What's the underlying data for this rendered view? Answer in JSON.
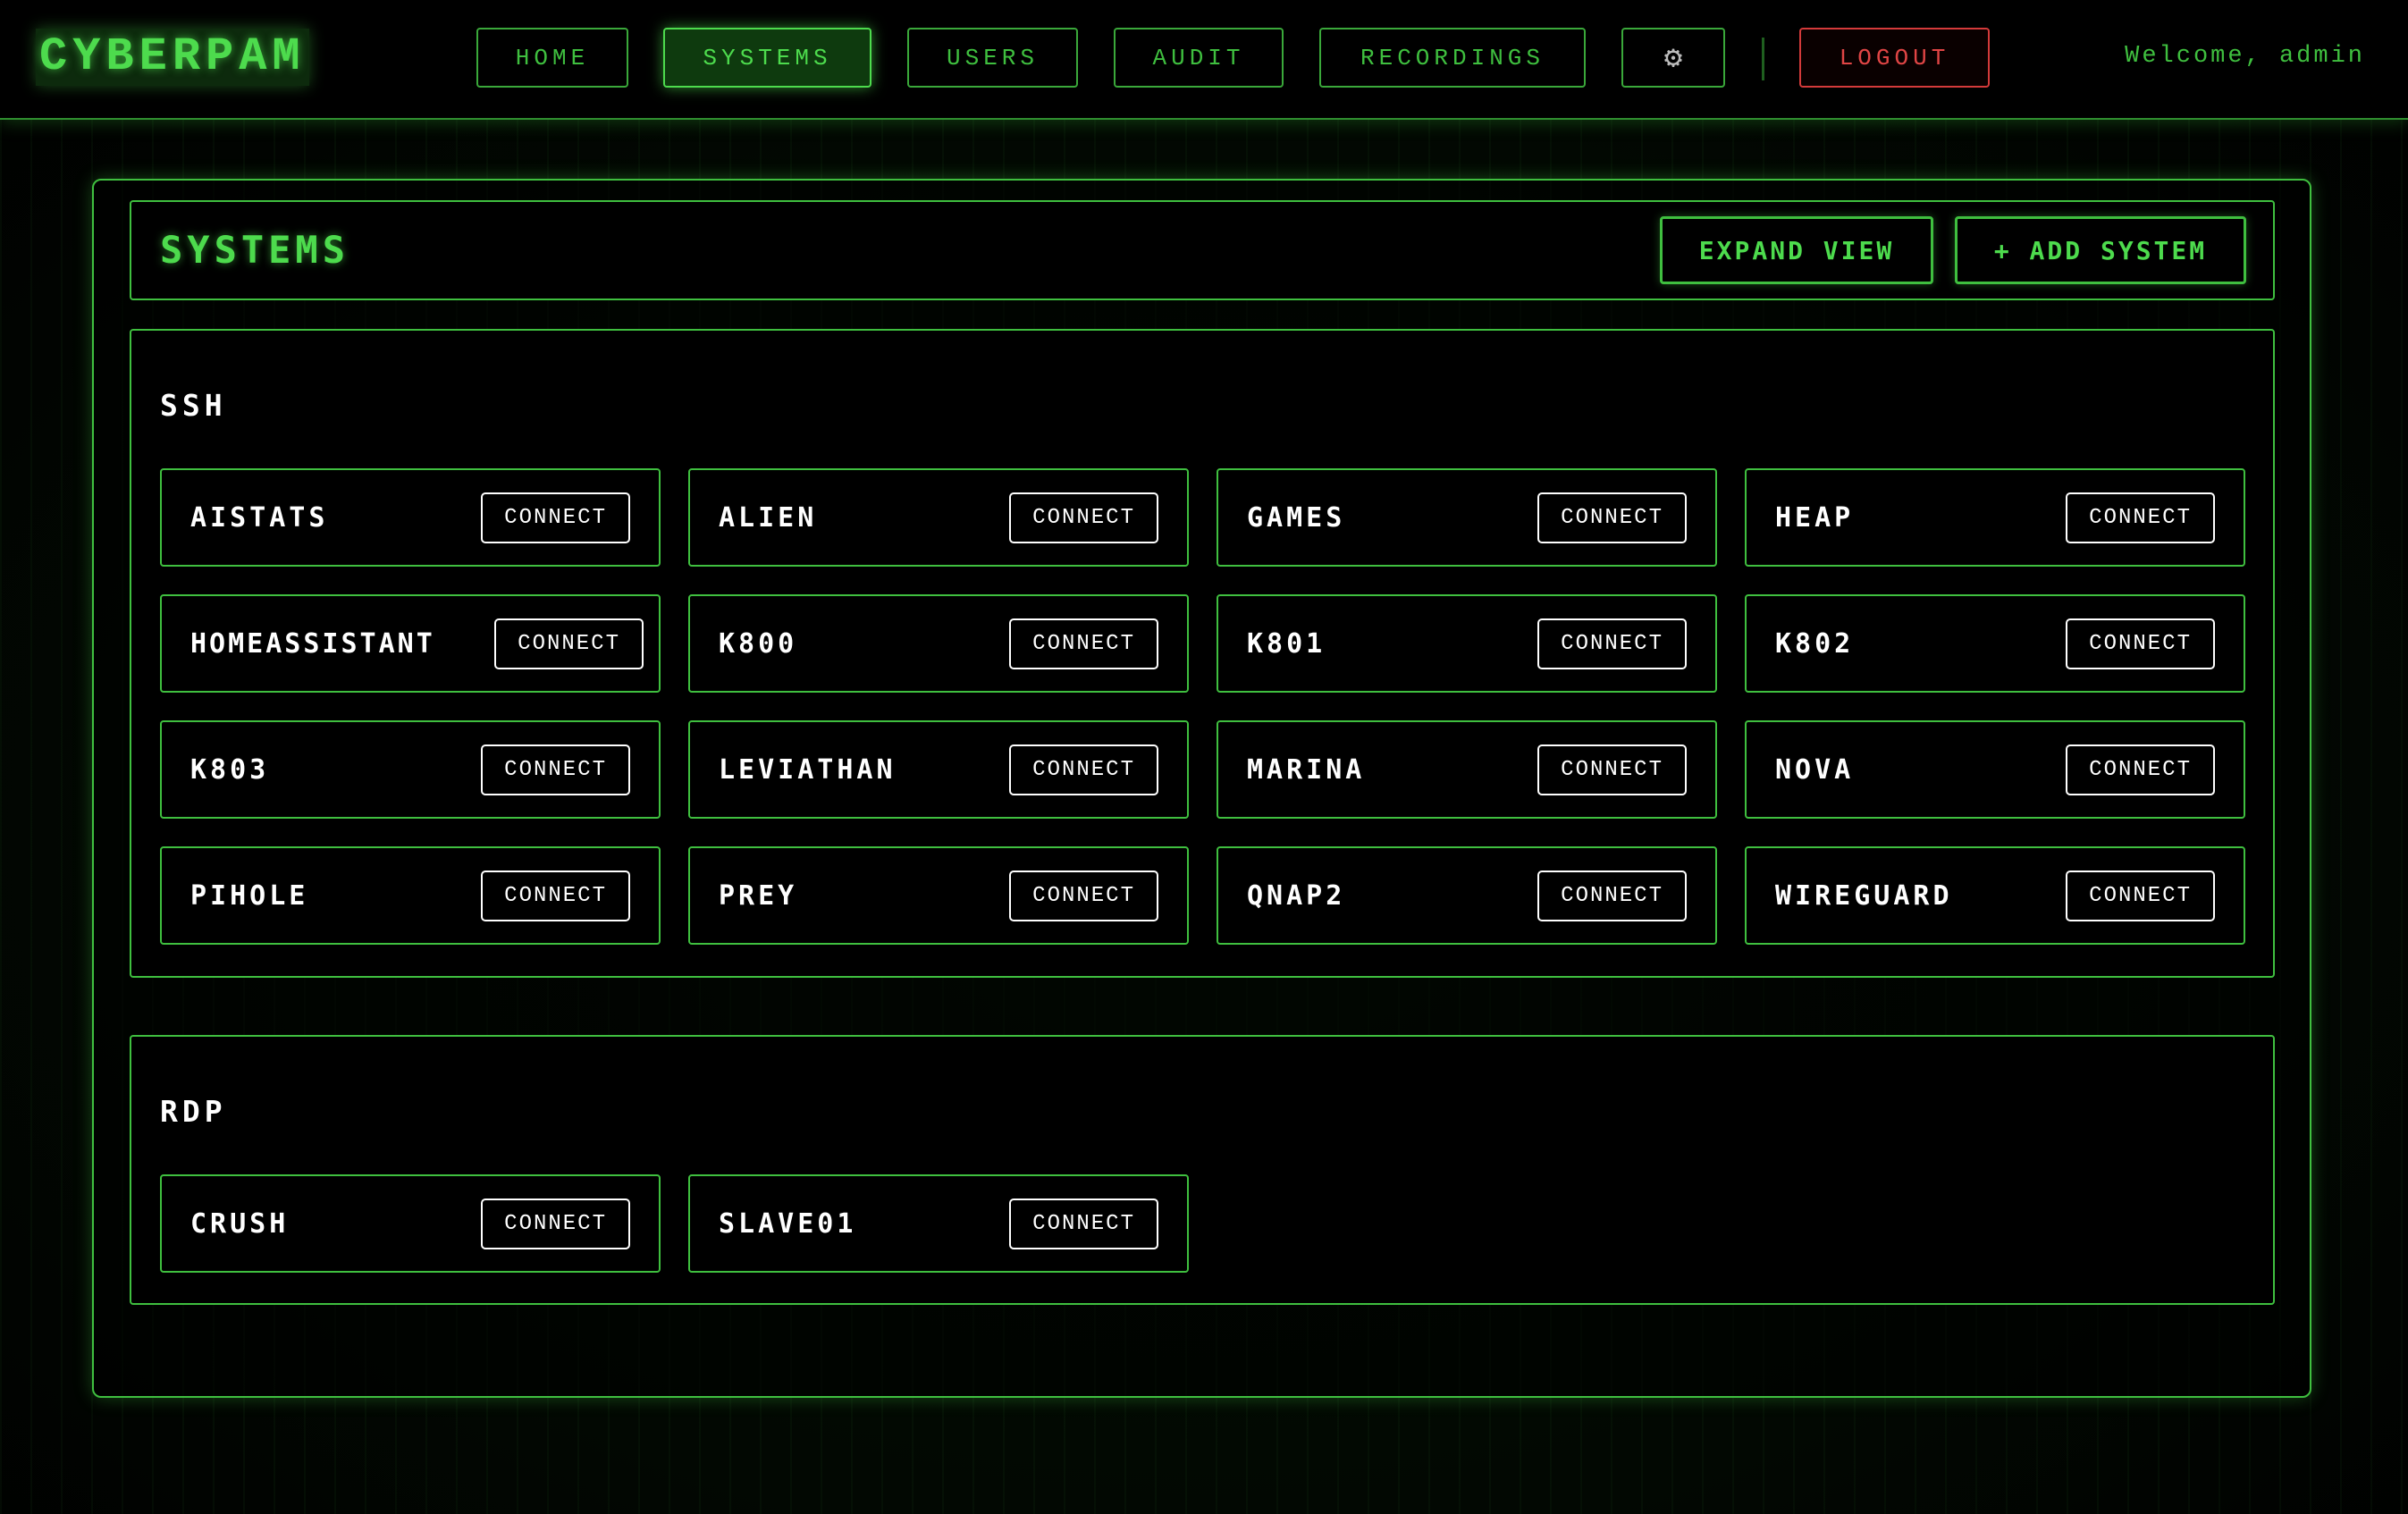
{
  "app": {
    "logo": "CYBERPAM",
    "welcome": "Welcome, admin"
  },
  "nav": {
    "home": "HOME",
    "systems": "SYSTEMS",
    "users": "USERS",
    "audit": "AUDIT",
    "recordings": "RECORDINGS",
    "settings_icon": "⚙",
    "logout": "LOGOUT"
  },
  "page": {
    "title": "SYSTEMS",
    "expand_label": "EXPAND VIEW",
    "add_label": "+ ADD SYSTEM"
  },
  "groups": [
    {
      "title": "SSH",
      "systems": [
        {
          "name": "AISTATS",
          "action": "CONNECT"
        },
        {
          "name": "ALIEN",
          "action": "CONNECT"
        },
        {
          "name": "GAMES",
          "action": "CONNECT"
        },
        {
          "name": "HEAP",
          "action": "CONNECT"
        },
        {
          "name": "HOMEASSISTANT",
          "action": "CONNECT"
        },
        {
          "name": "K800",
          "action": "CONNECT"
        },
        {
          "name": "K801",
          "action": "CONNECT"
        },
        {
          "name": "K802",
          "action": "CONNECT"
        },
        {
          "name": "K803",
          "action": "CONNECT"
        },
        {
          "name": "LEVIATHAN",
          "action": "CONNECT"
        },
        {
          "name": "MARINA",
          "action": "CONNECT"
        },
        {
          "name": "NOVA",
          "action": "CONNECT"
        },
        {
          "name": "PIHOLE",
          "action": "CONNECT"
        },
        {
          "name": "PREY",
          "action": "CONNECT"
        },
        {
          "name": "QNAP2",
          "action": "CONNECT"
        },
        {
          "name": "WIREGUARD",
          "action": "CONNECT"
        }
      ]
    },
    {
      "title": "RDP",
      "systems": [
        {
          "name": "CRUSH",
          "action": "CONNECT"
        },
        {
          "name": "SLAVE01",
          "action": "CONNECT"
        }
      ]
    }
  ],
  "colors": {
    "accent": "#4ddb4d",
    "border": "#3fbf3f",
    "logout": "#e04545",
    "background": "#000000"
  }
}
